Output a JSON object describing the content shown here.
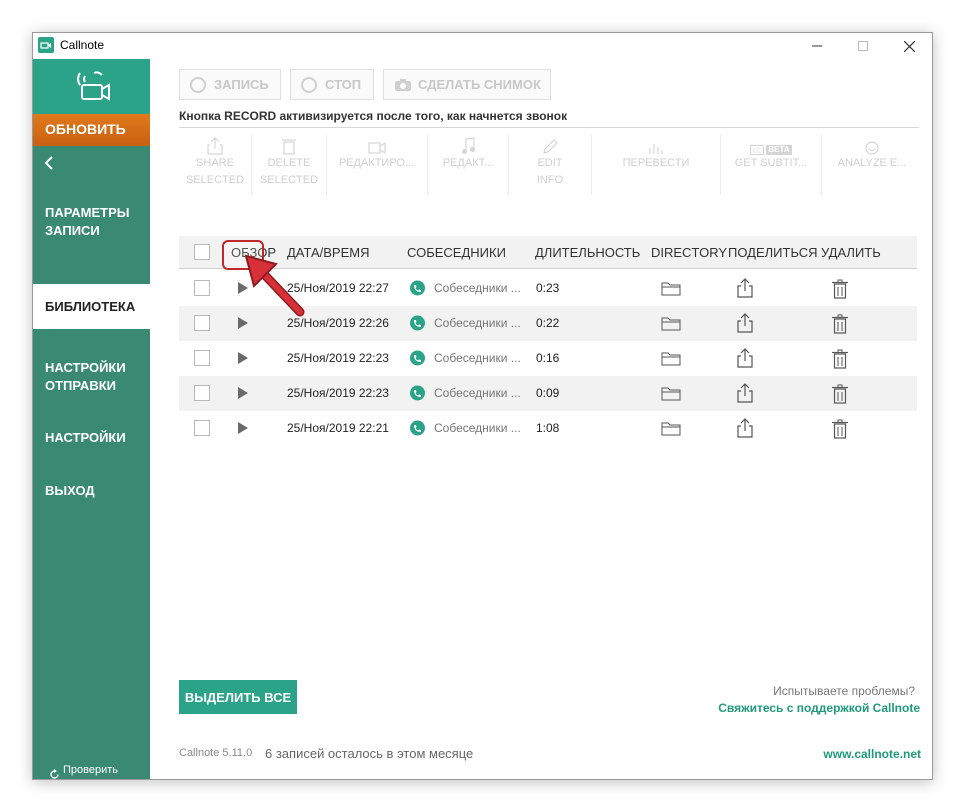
{
  "window": {
    "title": "Callnote",
    "minimize": "—",
    "maximize": "☐",
    "close": "✕"
  },
  "sidebar": {
    "update_label": "ОБНОВИТЬ",
    "back_label": "<",
    "items": [
      {
        "label": "ПАРАМЕТРЫ ЗАПИСИ"
      },
      {
        "label": "БИБЛИОТЕКА"
      },
      {
        "label": "НАСТРОЙКИ ОТПРАВКИ"
      },
      {
        "label": "НАСТРОЙКИ"
      },
      {
        "label": "ВЫХОД"
      }
    ],
    "active_index": 1,
    "license_label": "Проверить лицензию"
  },
  "top_buttons": {
    "record": "ЗАПИСЬ",
    "stop": "СТОП",
    "snapshot": "СДЕЛАТЬ СНИМОК"
  },
  "hint": "Кнопка RECORD активизируется после того, как начнется звонок",
  "toolbar": [
    {
      "label1": "SHARE",
      "label2": "SELECTED"
    },
    {
      "label1": "DELETE",
      "label2": "SELECTED"
    },
    {
      "label1": "РЕДАКТИРО...",
      "label2": ""
    },
    {
      "label1": "РЕДАКТ...",
      "label2": ""
    },
    {
      "label1": "EDIT",
      "label2": "INFO"
    },
    {
      "label1": "ПЕРЕВЕСТИ",
      "label2": ""
    },
    {
      "label1": "GET SUBTIT...",
      "label2": "",
      "badge": "BETA"
    },
    {
      "label1": "ANALYZE E...",
      "label2": ""
    }
  ],
  "table": {
    "columns": [
      "ОБЗОР",
      "ДАТА/ВРЕМЯ",
      "СОБЕСЕДНИКИ",
      "ДЛИТЕЛЬНОСТЬ",
      "DIRECTORY",
      "ПОДЕЛИТЬСЯ",
      "УДАЛИТЬ"
    ],
    "rows": [
      {
        "date": "25/Ноя/2019 22:27",
        "contact": "Собеседники ...",
        "duration": "0:23"
      },
      {
        "date": "25/Ноя/2019 22:26",
        "contact": "Собеседники ...",
        "duration": "0:22"
      },
      {
        "date": "25/Ноя/2019 22:23",
        "contact": "Собеседники ...",
        "duration": "0:16"
      },
      {
        "date": "25/Ноя/2019 22:23",
        "contact": "Собеседники ...",
        "duration": "0:09"
      },
      {
        "date": "25/Ноя/2019 22:21",
        "contact": "Собеседники ...",
        "duration": "1:08"
      }
    ]
  },
  "footer": {
    "select_all": "ВЫДЕЛИТЬ ВСЕ",
    "problems": "Испытываете проблемы?",
    "support": "Свяжитесь с поддержкой Callnote",
    "version": "Callnote 5.11.0",
    "remaining": "6 записей осталось в этом месяце",
    "site": "www.callnote.net"
  },
  "colors": {
    "brand_green": "#2aa389",
    "sidebar_green": "#3a8a73",
    "update_orange": "#d96a16",
    "viber_purple": "#2aa389",
    "annotation_red": "#c0272d"
  }
}
